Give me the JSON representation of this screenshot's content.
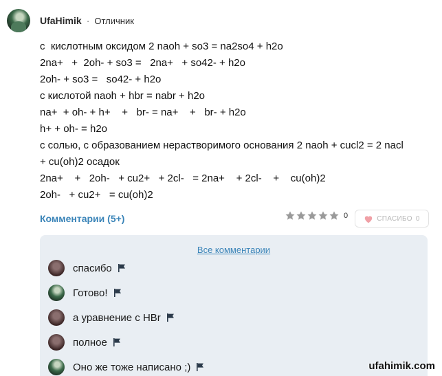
{
  "author": {
    "name": "UfaHimik",
    "separator": "·",
    "rank": "Отличник"
  },
  "answer_lines": [
    "с  кислотным оксидом 2 naoh + so3 = na2so4 + h2o",
    "2na+   +  2oh- + so3 =   2na+   + so42- + h2o",
    "2oh- + so3 =   so42- + h2o",
    "с кислотой naoh + hbr = nabr + h2o",
    "na+  + oh- + h+    +   br- = na+    +   br- + h2o",
    "h+ + oh- = h2o",
    "с солью, с образованием нерастворимого основания 2 naoh + cucl2 = 2 nacl",
    "+ cu(oh)2 осадок",
    "2na+    +   2oh-   + cu2+   + 2cl-   = 2na+    + 2cl-    +    cu(oh)2",
    "2oh-   + cu2+   = cu(oh)2"
  ],
  "comments_link": "Комментарии (5+)",
  "rating": {
    "stars_filled": 0,
    "stars_total": 5,
    "count": "0"
  },
  "thanks": {
    "label": "СПАСИБО",
    "count": "0"
  },
  "all_comments_label": "Все комментарии",
  "comments": [
    {
      "text": "спасибо",
      "avatar": "dark"
    },
    {
      "text": "Готово!",
      "avatar": "green"
    },
    {
      "text": "а уравнение с HBr",
      "avatar": "dark"
    },
    {
      "text": "полное",
      "avatar": "dark"
    },
    {
      "text": "Оно же тоже написано ;)",
      "avatar": "green"
    }
  ],
  "watermark": "ufahimik.com",
  "colors": {
    "link_blue": "#3a84b8",
    "comments_bg": "#e9eef3",
    "star_gray": "#9a9a9a",
    "heart_pink": "#f0a0a6"
  }
}
